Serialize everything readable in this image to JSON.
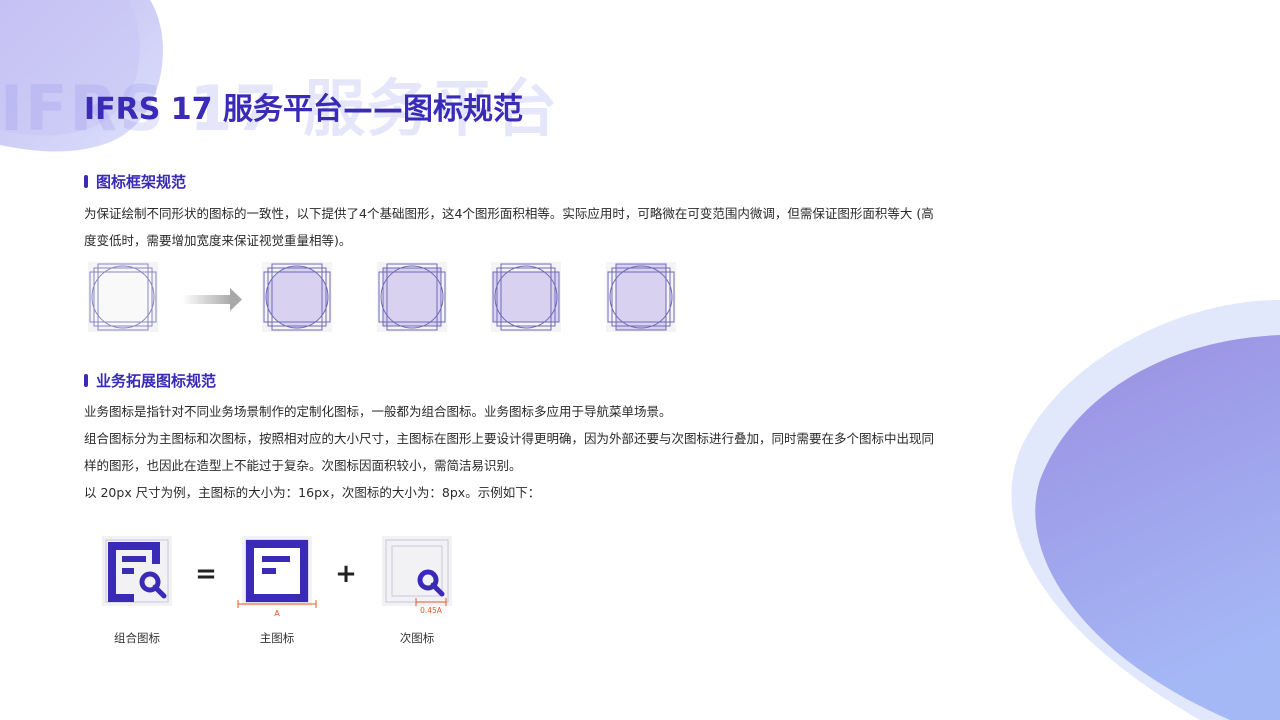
{
  "ghost_title": "IFRS 17 服务平台",
  "title": "IFRS 17 服务平台——图标规范",
  "section1": {
    "heading": "图标框架规范",
    "text": "为保证绘制不同形状的图标的一致性，以下提供了4个基础图形，这4个图形面积相等。实际应用时，可略微在可变范围内微调，但需保证图形面积等大 (高度变低时，需要增加宽度来保证视觉重量相等)。"
  },
  "section2": {
    "heading": "业务拓展图标规范",
    "lines": [
      "业务图标是指针对不同业务场景制作的定制化图标，一般都为组合图标。业务图标多应用于导航菜单场景。",
      "组合图标分为主图标和次图标，按照相对应的大小尺寸，主图标在图形上要设计得更明确，因为外部还要与次图标进行叠加，同时需要在多个图标中出现同样的图形，也因此在造型上不能过于复杂。次图标因面积较小，需简洁易识别。",
      "以 20px 尺寸为例，主图标的大小为：16px，次图标的大小为：8px。示例如下："
    ]
  },
  "example": {
    "equals": "=",
    "plus": "+",
    "measure_main": "A",
    "measure_secondary": "0.45A",
    "labels": [
      "组合图标",
      "主图标",
      "次图标"
    ]
  },
  "colors": {
    "primary": "#3a2ab8",
    "fill_light": "#d8d2f0",
    "measure": "#e8582a"
  }
}
